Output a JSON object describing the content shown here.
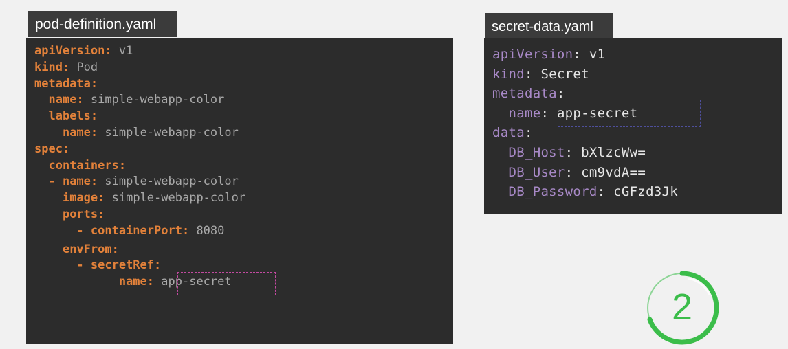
{
  "left_file": {
    "tab_label": "pod-definition.yaml",
    "lines": [
      {
        "indent": "",
        "key": "apiVersion",
        "sep": ": ",
        "value": "v1"
      },
      {
        "indent": "",
        "key": "kind",
        "sep": ": ",
        "value": "Pod"
      },
      {
        "indent": "",
        "key": "metadata",
        "sep": ":",
        "value": ""
      },
      {
        "indent": "  ",
        "key": "name",
        "sep": ": ",
        "value": "simple-webapp-color"
      },
      {
        "indent": "  ",
        "key": "labels",
        "sep": ":",
        "value": ""
      },
      {
        "indent": "    ",
        "key": "name",
        "sep": ": ",
        "value": "simple-webapp-color"
      },
      {
        "indent": "",
        "key": "spec",
        "sep": ":",
        "value": ""
      },
      {
        "indent": "  ",
        "key": "containers",
        "sep": ":",
        "value": ""
      },
      {
        "indent": "  - ",
        "key": "name",
        "sep": ": ",
        "value": "simple-webapp-color"
      },
      {
        "indent": "    ",
        "key": "image",
        "sep": ": ",
        "value": "simple-webapp-color"
      },
      {
        "indent": "    ",
        "key": "ports",
        "sep": ":",
        "value": ""
      },
      {
        "indent": "      - ",
        "key": "containerPort",
        "sep": ": ",
        "value": "8080"
      },
      {
        "indent": "    ",
        "key": "envFrom",
        "sep": ":",
        "value": ""
      },
      {
        "indent": "      - ",
        "key": "secretRef",
        "sep": ":",
        "value": ""
      },
      {
        "indent": "            ",
        "key": "name",
        "sep": ": ",
        "value": "app-secret"
      }
    ]
  },
  "right_file": {
    "tab_label": "secret-data.yaml",
    "lines": [
      {
        "indent": "",
        "key": "apiVersion",
        "sep": ": ",
        "value": "v1"
      },
      {
        "indent": "",
        "key": "kind",
        "sep": ": ",
        "value": "Secret"
      },
      {
        "indent": "",
        "key": "metadata",
        "sep": ":",
        "value": ""
      },
      {
        "indent": "  ",
        "key": "name",
        "sep": ": ",
        "value": "app-secret"
      },
      {
        "indent": "",
        "key": "data",
        "sep": ":",
        "value": ""
      },
      {
        "indent": "  ",
        "key": "DB_Host",
        "sep": ": ",
        "value": "bXlzcWw="
      },
      {
        "indent": "  ",
        "key": "DB_User",
        "sep": ": ",
        "value": "cm9vdA=="
      },
      {
        "indent": "  ",
        "key": "DB_Password",
        "sep": ": ",
        "value": "cGFzd3Jk"
      }
    ]
  },
  "step_badge": {
    "number": "2",
    "color": "#3bbd4a"
  },
  "colors": {
    "left_key": "#e2813a",
    "right_key": "#a889c7",
    "highlight_left": "#c24aa0",
    "highlight_right": "#4e4f9c"
  }
}
